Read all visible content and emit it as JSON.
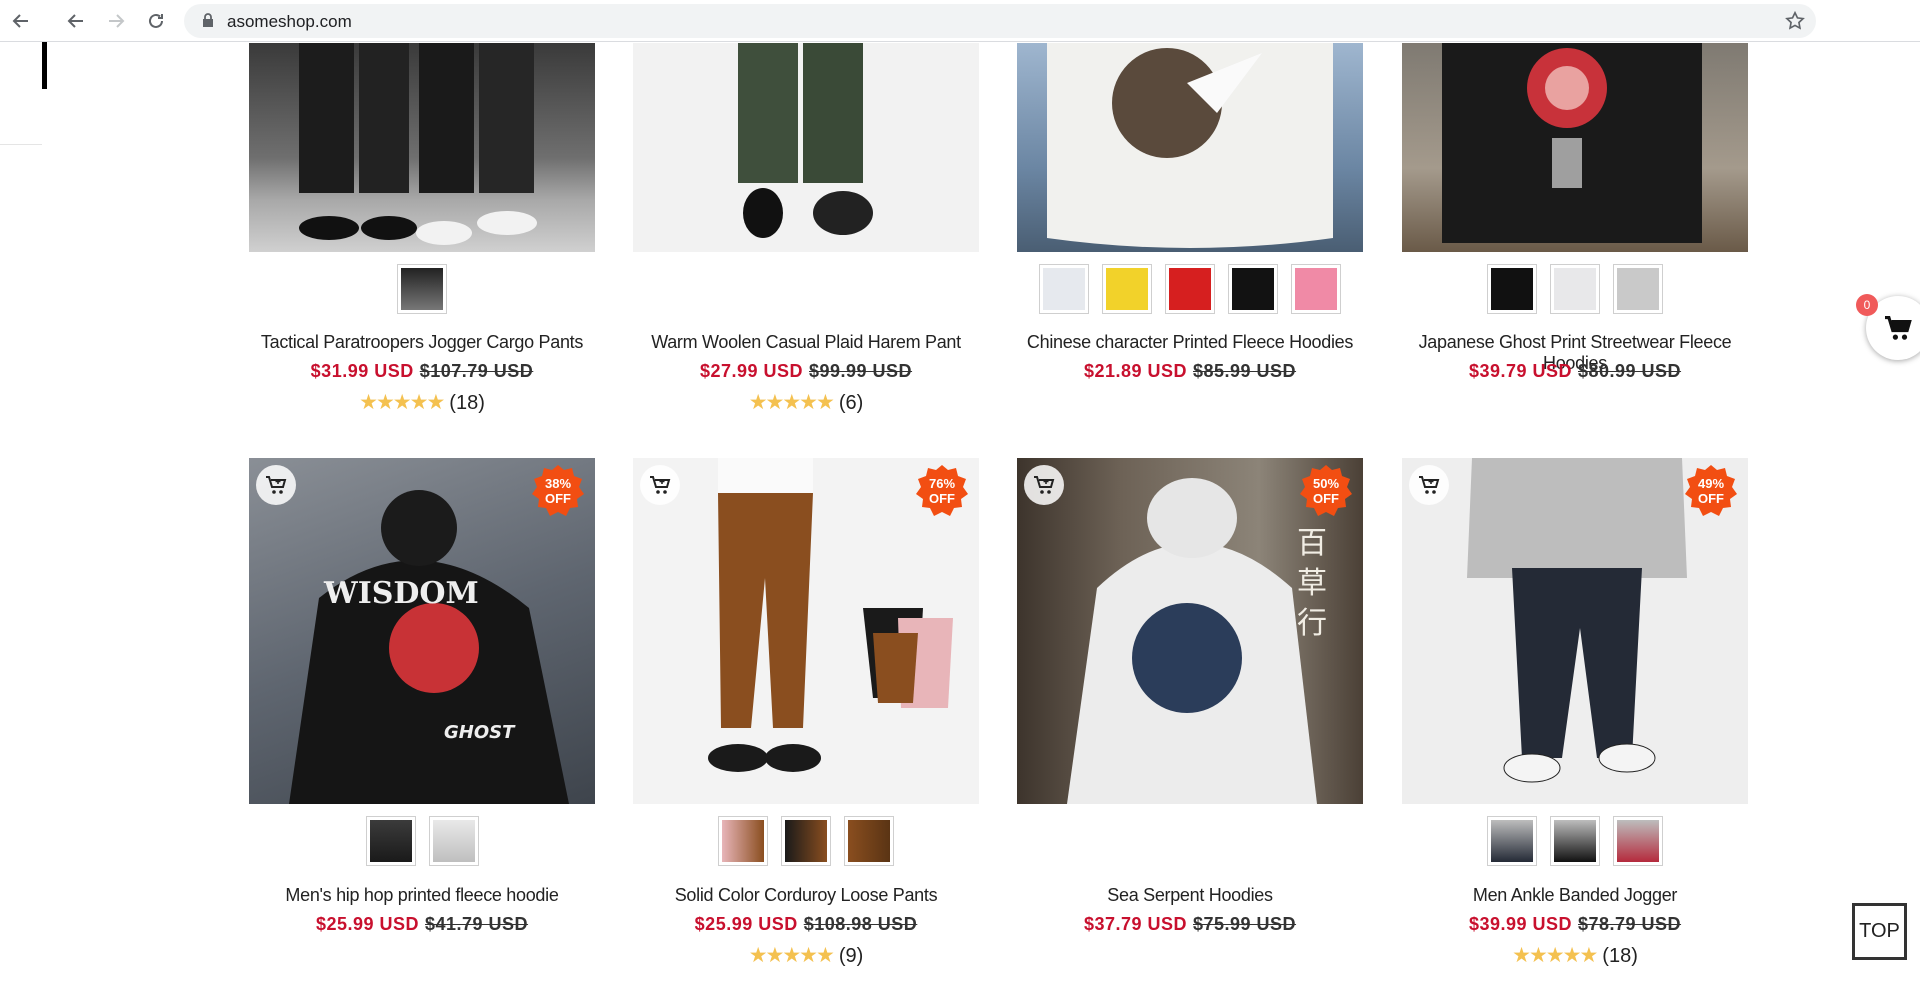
{
  "browser": {
    "url": "asomeshop.com"
  },
  "products_row1": [
    {
      "title": "Tactical Paratroopers Jogger Cargo Pants",
      "price": "$31.99 USD",
      "was": "$107.79 USD",
      "rating_count": "(18)",
      "stars": "★★★★★"
    },
    {
      "title": "Warm Woolen Casual Plaid Harem Pant",
      "price": "$27.99 USD",
      "was": "$99.99 USD",
      "rating_count": "(6)",
      "stars": "★★★★★"
    },
    {
      "title": "Chinese character Printed Fleece Hoodies",
      "price": "$21.89 USD",
      "was": "$85.99 USD"
    },
    {
      "title": "Japanese Ghost Print Streetwear Fleece Hoodies",
      "price": "$39.79 USD",
      "was": "$80.99 USD"
    }
  ],
  "products_row2": [
    {
      "title": "Men's hip hop printed fleece hoodie",
      "price": "$25.99 USD",
      "was": "$41.79 USD",
      "badge": "38%\nOFF"
    },
    {
      "title": "Solid Color Corduroy Loose Pants",
      "price": "$25.99 USD",
      "was": "$108.98 USD",
      "badge": "76%\nOFF",
      "rating_count": "(9)",
      "stars": "★★★★★"
    },
    {
      "title": "Sea Serpent Hoodies",
      "price": "$37.79 USD",
      "was": "$75.99 USD",
      "badge": "50%\nOFF"
    },
    {
      "title": "Men Ankle Banded Jogger",
      "price": "$39.99 USD",
      "was": "$78.79 USD",
      "badge": "49%\nOFF",
      "rating_count": "(18)",
      "stars": "★★★★★"
    }
  ],
  "cart": {
    "count": "0"
  },
  "top_button": "TOP",
  "colors": {
    "price": "#c8102e",
    "badge": "#f24e12",
    "star": "#f4c150"
  }
}
